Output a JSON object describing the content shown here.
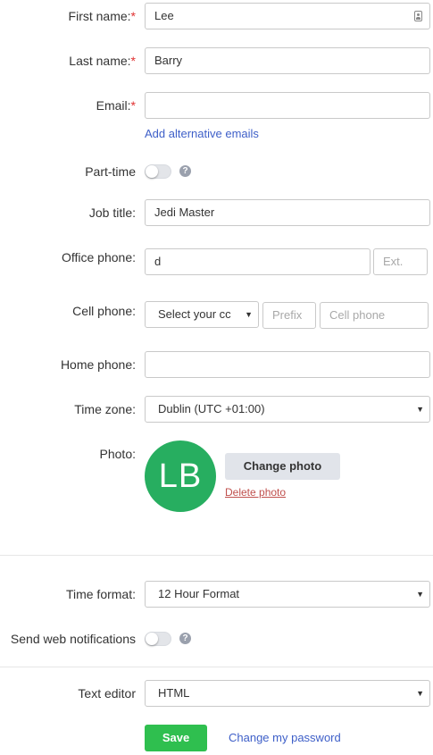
{
  "fields": {
    "first_name": {
      "label": "First name:",
      "required": "*",
      "value": "Lee"
    },
    "last_name": {
      "label": "Last name:",
      "required": "*",
      "value": "Barry"
    },
    "email": {
      "label": "Email:",
      "required": "*",
      "value": ""
    },
    "add_alt_emails": "Add alternative emails",
    "part_time": {
      "label": "Part-time",
      "on": false
    },
    "job_title": {
      "label": "Job title:",
      "value": "Jedi Master"
    },
    "office_phone": {
      "label": "Office phone:",
      "value": "d",
      "ext_placeholder": "Ext."
    },
    "cell_phone": {
      "label": "Cell phone:",
      "country_value": "Select your cc",
      "prefix_placeholder": "Prefix",
      "number_placeholder": "Cell phone"
    },
    "home_phone": {
      "label": "Home phone:",
      "value": ""
    },
    "time_zone": {
      "label": "Time zone:",
      "value": "Dublin (UTC +01:00)"
    },
    "photo": {
      "label": "Photo:",
      "initials": "LB",
      "avatar_color": "#27ae60",
      "change_label": "Change photo",
      "delete_label": "Delete photo"
    },
    "time_format": {
      "label": "Time format:",
      "value": "12 Hour Format"
    },
    "web_notifications": {
      "label": "Send web notifications",
      "on": false
    },
    "text_editor": {
      "label": "Text editor",
      "value": "HTML"
    }
  },
  "actions": {
    "save_label": "Save",
    "change_password_label": "Change my password"
  },
  "icons": {
    "help": "?",
    "caret": "▼"
  },
  "colors": {
    "link": "#3e5fc8",
    "required": "#e03131",
    "save": "#2fbf4f",
    "delete_link": "#c0504d"
  }
}
